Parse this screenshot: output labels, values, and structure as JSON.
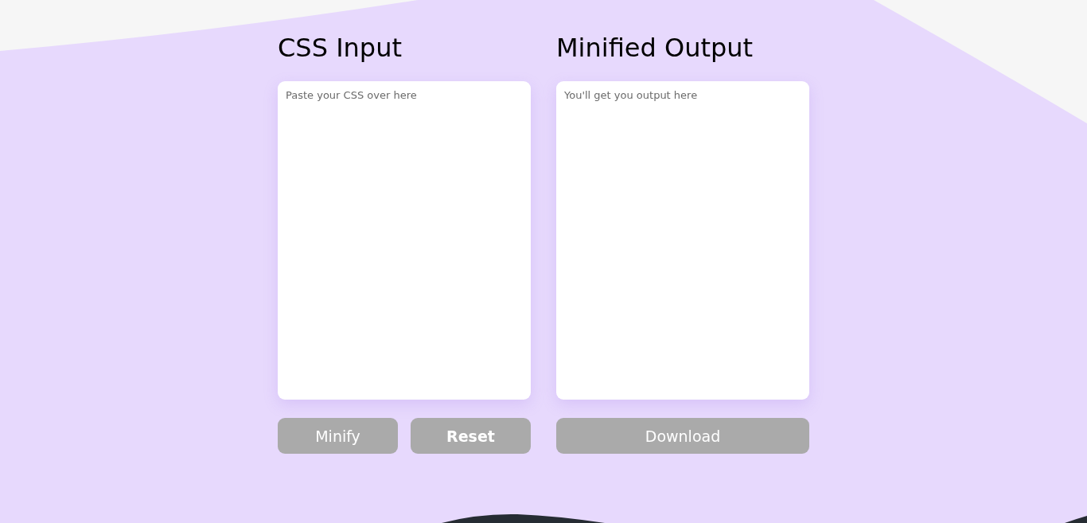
{
  "panels": [
    {
      "title": "CSS Input",
      "field": {
        "placeholder": "Paste your CSS over here"
      },
      "buttons": [
        {
          "label": "Minify",
          "hovered": false
        },
        {
          "label": "Reset",
          "hovered": true
        }
      ]
    },
    {
      "title": "Minified Output",
      "field": {
        "placeholder": "You'll get you output here"
      },
      "buttons": [
        {
          "label": "Download",
          "hovered": false
        }
      ]
    }
  ]
}
